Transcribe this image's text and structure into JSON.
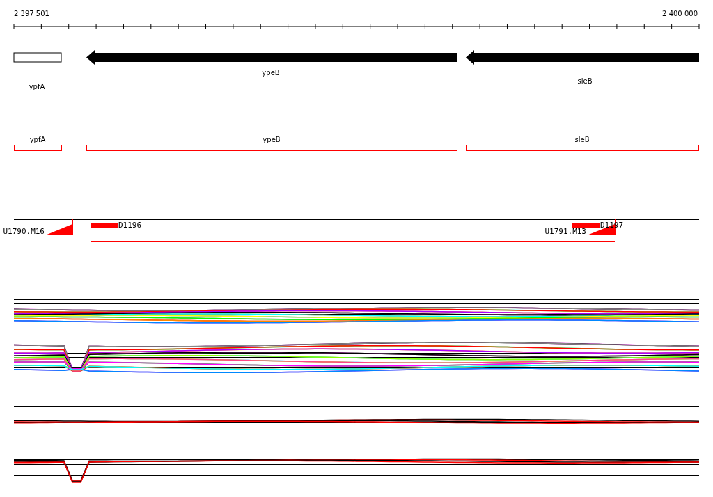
{
  "ruler": {
    "start": "2 397 501",
    "end": "2 400 000"
  },
  "genes": [
    {
      "name": "ypfA",
      "kind": "box"
    },
    {
      "name": "ypeB",
      "kind": "arrow"
    },
    {
      "name": "sleB",
      "kind": "arrow"
    }
  ],
  "cds": [
    {
      "name": "ypfA"
    },
    {
      "name": "ypeB"
    },
    {
      "name": "sleB"
    }
  ],
  "features": [
    {
      "name": "U1790.M16",
      "kind": "ramp"
    },
    {
      "name": "D1196",
      "kind": "block"
    },
    {
      "name": "U1791.M13",
      "kind": "ramp"
    },
    {
      "name": "D1197",
      "kind": "block"
    }
  ]
}
